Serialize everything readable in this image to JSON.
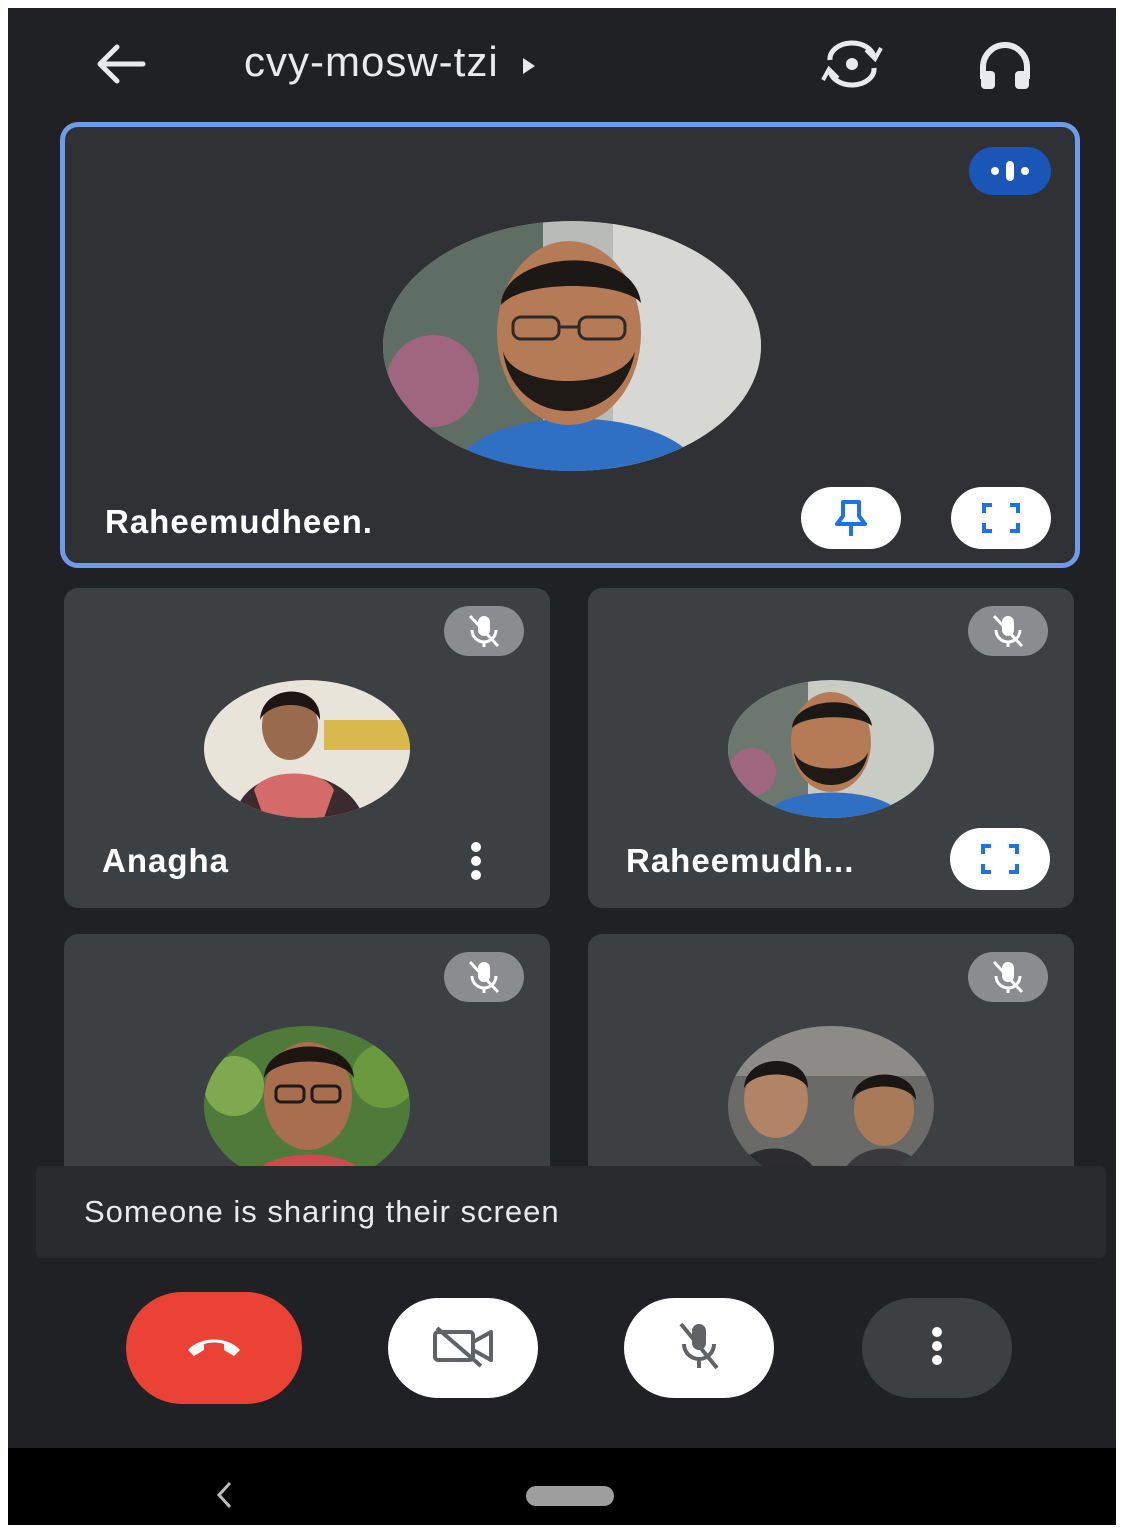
{
  "header": {
    "meeting_code": "cvy-mosw-tzi",
    "back_icon": "arrow-back-icon",
    "switch_camera_icon": "switch-camera-icon",
    "audio_icon": "headphones-icon"
  },
  "main_tile": {
    "name": "Raheemudheen.",
    "speaking_icon": "audio-level-icon",
    "pin_icon": "pin-icon",
    "fullscreen_icon": "fullscreen-icon"
  },
  "participants": [
    {
      "name": "Anagha",
      "muted": true,
      "menu_icon": "more-vert-icon"
    },
    {
      "name": "Raheemudh...",
      "muted": true,
      "fullscreen_icon": "fullscreen-icon"
    },
    {
      "name": "",
      "muted": true
    },
    {
      "name": "",
      "muted": true
    }
  ],
  "banner": {
    "text": "Someone is sharing their screen"
  },
  "controls": {
    "end_call_icon": "call-end-icon",
    "camera_icon": "videocam-off-icon",
    "mic_icon": "mic-off-icon",
    "more_icon": "more-vert-icon"
  },
  "colors": {
    "accent_blue": "#1a73e8",
    "active_border": "#6f9bea",
    "end_call_red": "#ea4335",
    "background": "#202124",
    "tile": "#3c4043"
  },
  "system_nav": {
    "back_icon": "nav-back-icon",
    "home_icon": "home-pill-icon"
  }
}
